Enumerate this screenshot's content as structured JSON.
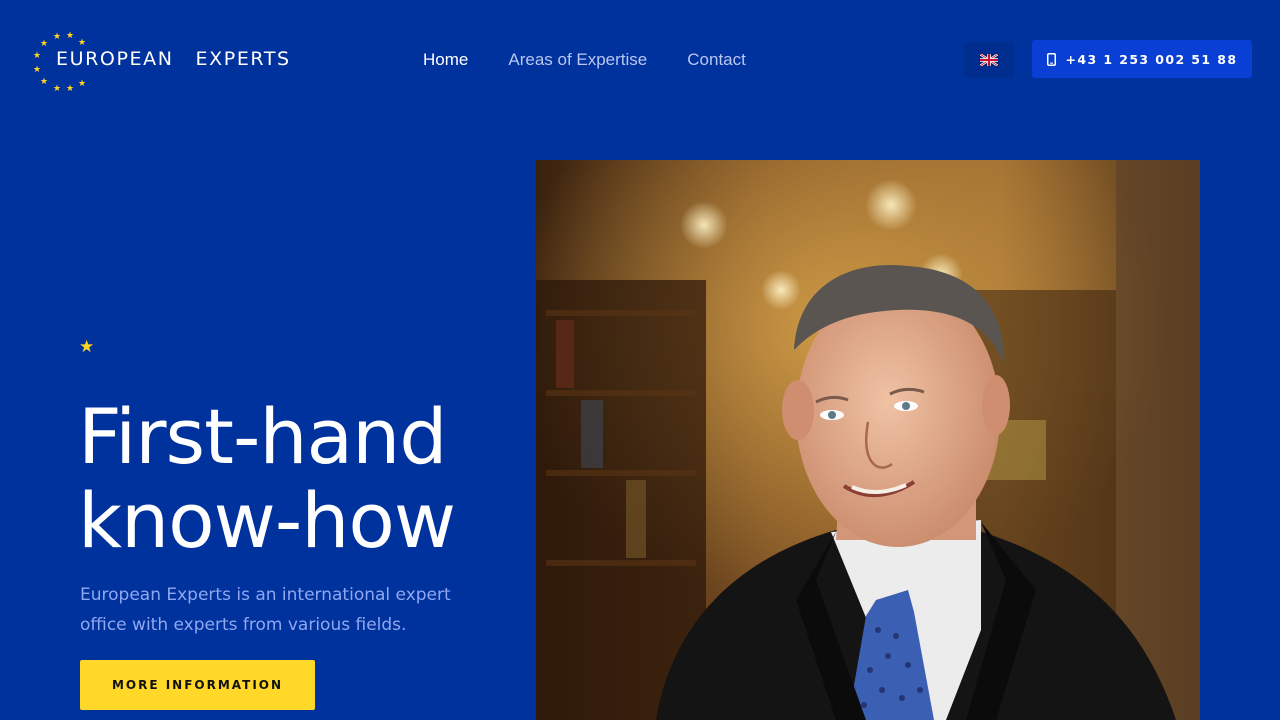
{
  "brand": {
    "word1": "EUROPEAN",
    "word2": "EXPERTS"
  },
  "nav": {
    "items": [
      {
        "label": "Home",
        "active": true
      },
      {
        "label": "Areas of Expertise",
        "active": false
      },
      {
        "label": "Contact",
        "active": false
      }
    ]
  },
  "language": {
    "icon": "uk-flag-icon"
  },
  "phone": {
    "number": "+43 1 253 002 51 88",
    "icon": "mobile-phone-icon"
  },
  "hero": {
    "star_icon": "star-icon",
    "headline_line1": "First-hand",
    "headline_line2": "know-how",
    "subtitle": "European Experts is an international expert office with experts from various fields.",
    "cta_label": "MORE INFORMATION"
  },
  "colors": {
    "background": "#00329e",
    "accent_yellow": "#ffd82a",
    "phone_button": "#0a3fd6",
    "nav_inactive": "#b9c6f0"
  }
}
